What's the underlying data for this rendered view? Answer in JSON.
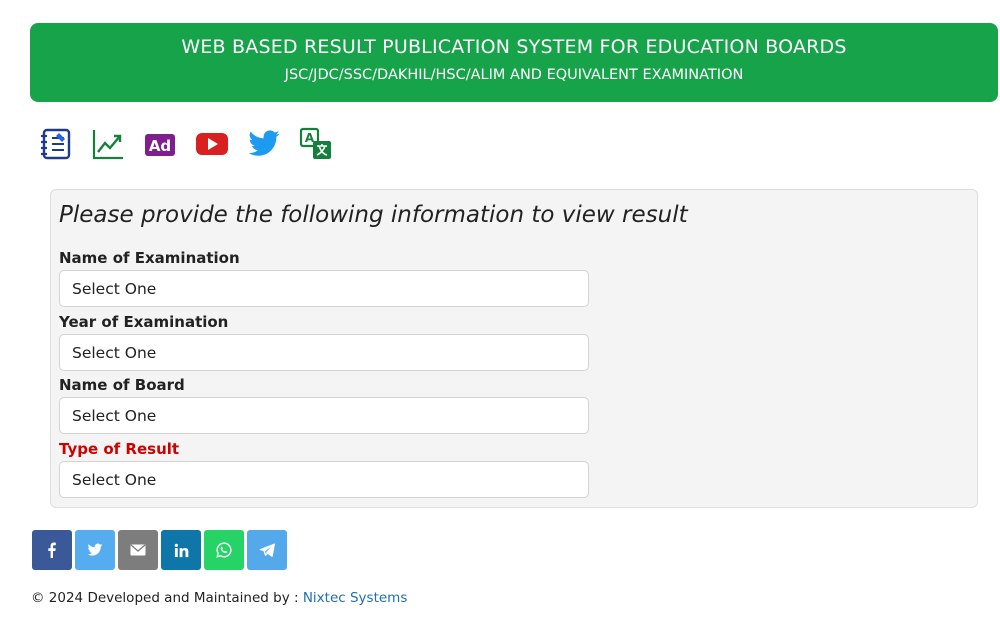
{
  "header": {
    "title": "WEB BASED RESULT PUBLICATION SYSTEM FOR EDUCATION BOARDS",
    "subtitle": "JSC/JDC/SSC/DAKHIL/HSC/ALIM AND EQUIVALENT EXAMINATION",
    "background": "#16a34a"
  },
  "toolbar": {
    "icons": [
      "notebook-icon",
      "trending-chart-icon",
      "ad-icon",
      "youtube-icon",
      "twitter-icon",
      "translate-icon"
    ],
    "ad_label": "Ad"
  },
  "form": {
    "heading": "Please provide the following information to view result",
    "fields": [
      {
        "label": "Name of Examination",
        "value": "Select One"
      },
      {
        "label": "Year of Examination",
        "value": "Select One"
      },
      {
        "label": "Name of Board",
        "value": "Select One"
      },
      {
        "label": "Type of Result",
        "value": "Select One",
        "label_color": "#d10000"
      }
    ]
  },
  "share": {
    "buttons": [
      {
        "icon": "facebook-icon",
        "color": "#3b5998"
      },
      {
        "icon": "twitter-icon",
        "color": "#55acee"
      },
      {
        "icon": "email-icon",
        "color": "#7d7d7d"
      },
      {
        "icon": "linkedin-icon",
        "color": "#0e76a8"
      },
      {
        "icon": "whatsapp-icon",
        "color": "#25d366"
      },
      {
        "icon": "telegram-icon",
        "color": "#54a9eb"
      }
    ]
  },
  "footer": {
    "text": "© 2024 Developed and Maintained by : ",
    "link": "Nixtec Systems"
  }
}
